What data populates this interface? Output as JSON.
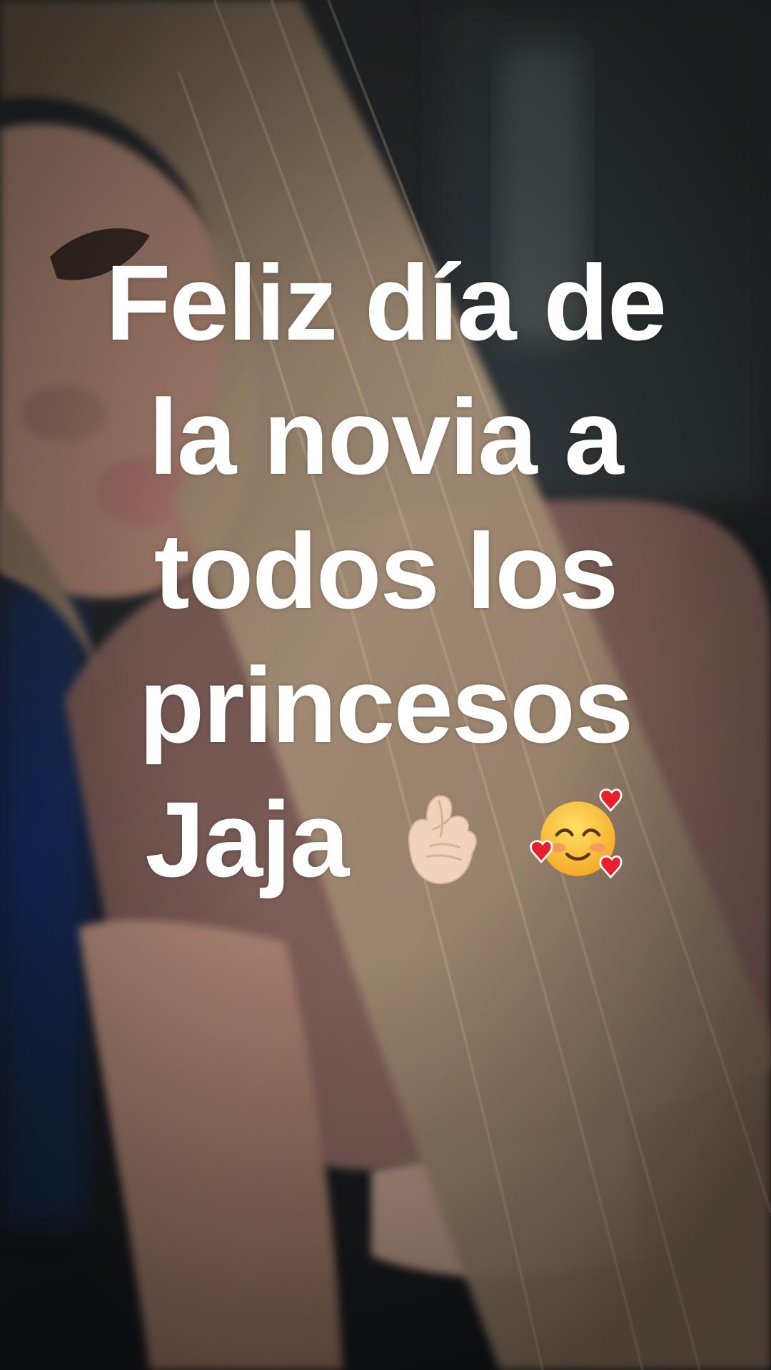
{
  "caption": {
    "line1": "Feliz día de",
    "line2": "la novia a",
    "line3": "todos los",
    "line4": "princesos",
    "line5": "Jaja"
  },
  "emojis": [
    "crossed-fingers-icon",
    "smiling-face-with-hearts-icon"
  ],
  "colors": {
    "caption_text": "#ffffff",
    "hair": "#a08a72",
    "shirt": "#7a5a55",
    "skin": "#a47d6e",
    "background": "#1f2224"
  }
}
